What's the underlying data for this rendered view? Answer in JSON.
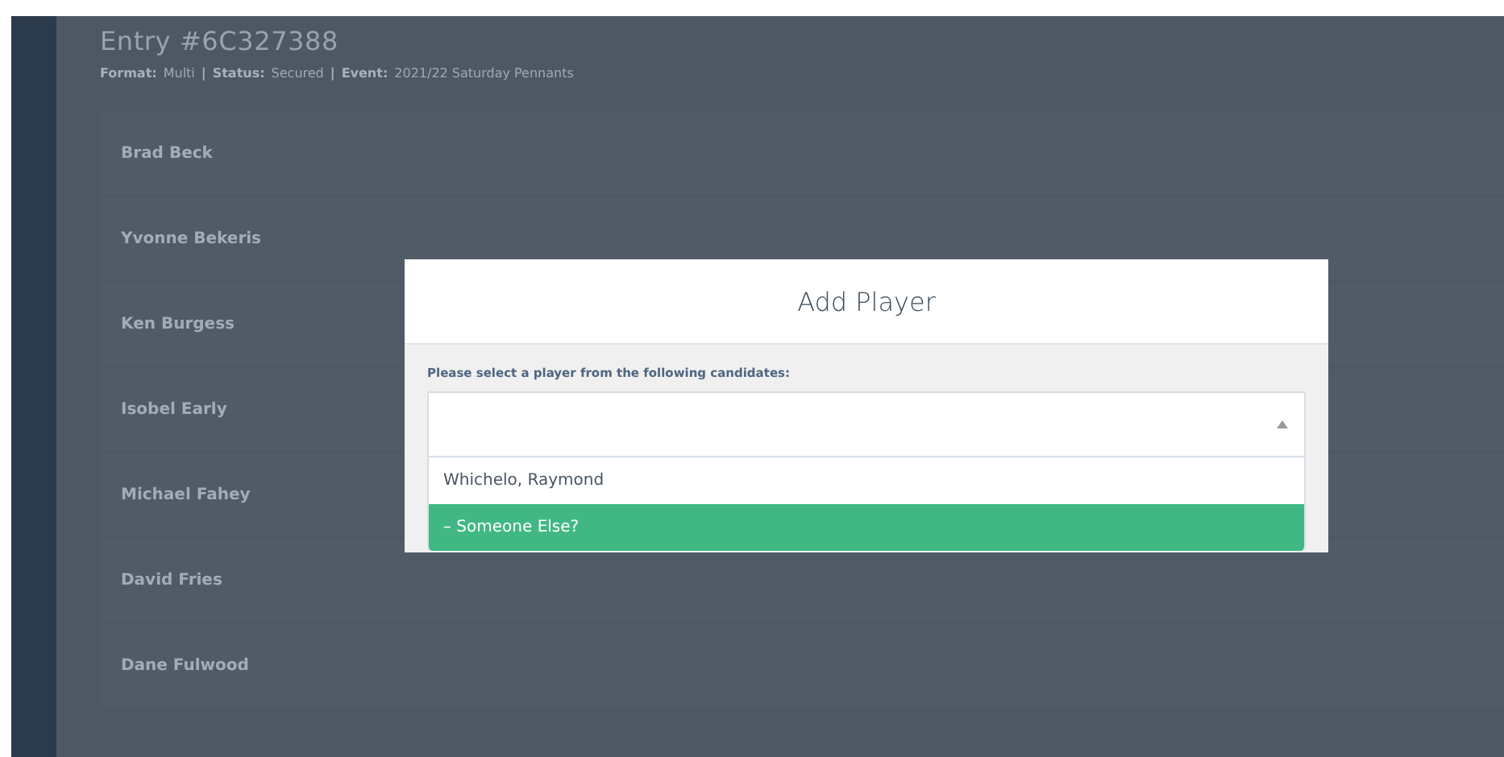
{
  "entry": {
    "title": "Entry #6C327388",
    "meta": [
      {
        "label": "Format:",
        "value": "Multi"
      },
      {
        "label": "Status:",
        "value": "Secured"
      },
      {
        "label": "Event:",
        "value": "2021/22 Saturday Pennants"
      }
    ],
    "separator": "|",
    "players": [
      "Brad Beck",
      "Yvonne Bekeris",
      "Ken Burgess",
      "Isobel Early",
      "Michael Fahey",
      "David Fries",
      "Dane Fulwood"
    ]
  },
  "modal": {
    "title": "Add Player",
    "prompt": "Please select a player from the following candidates:",
    "select": {
      "expanded": true,
      "options": [
        {
          "label": "Whichelo, Raymond",
          "selected": false
        },
        {
          "label": "– Someone Else?",
          "selected": true
        }
      ]
    }
  }
}
